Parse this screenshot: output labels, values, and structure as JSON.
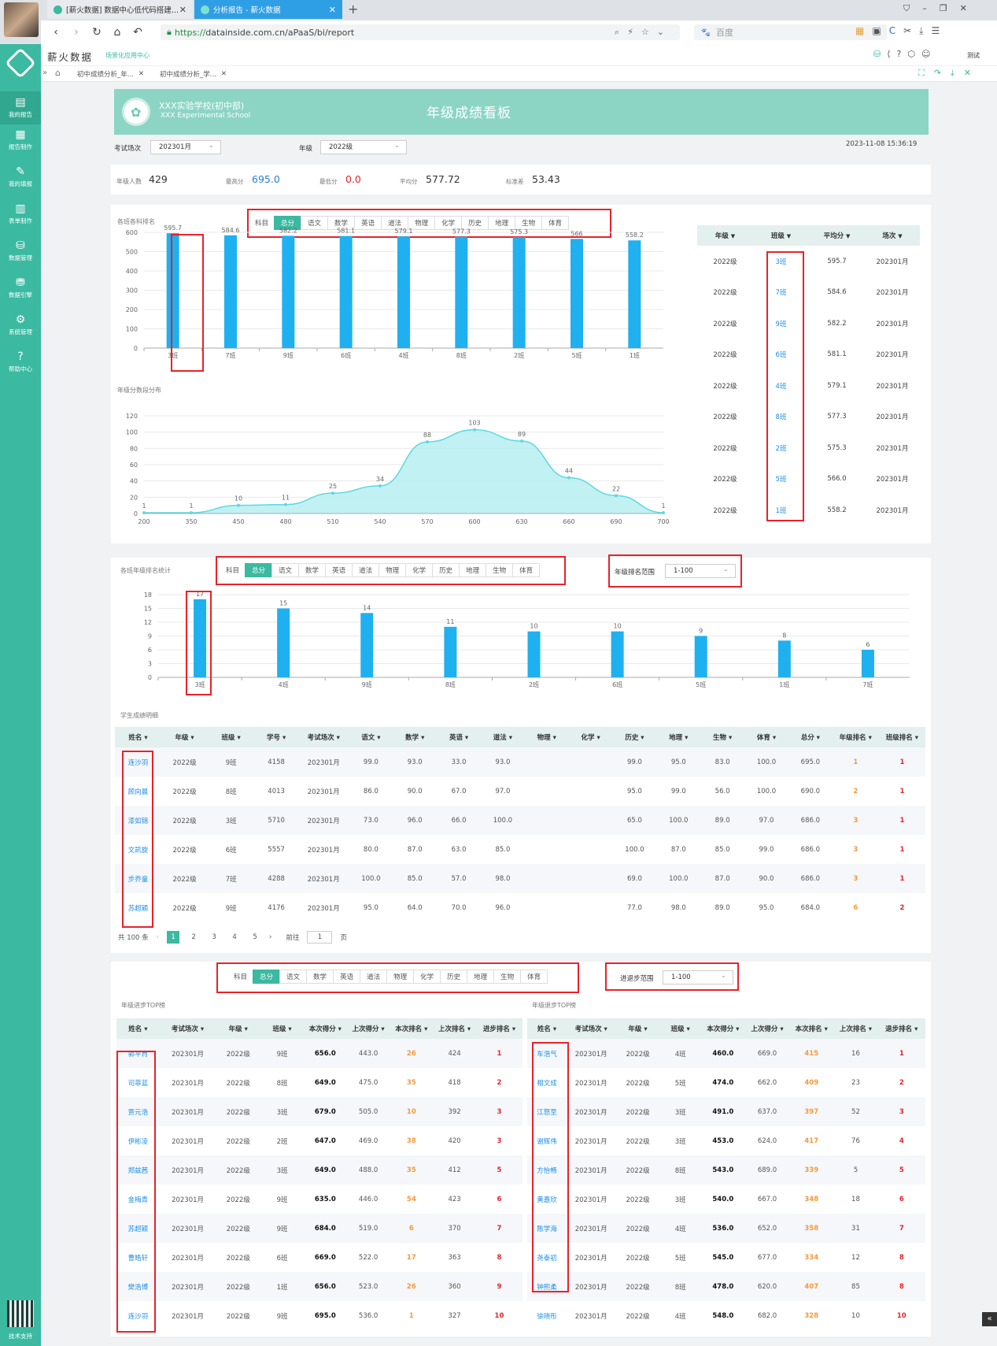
{
  "browser": {
    "tabs": [
      {
        "title": "[薪火数据] 数据中心低代码搭建..."
      },
      {
        "title": "分析报告 - 薪火数据"
      }
    ],
    "url_secure": "https://",
    "url": "datainside.com.cn/aPaaS/bi/report",
    "search_placeholder": "百度",
    "new_tab": "+"
  },
  "app": {
    "brand": "薪火数据",
    "sub_link": "场景化应用中心",
    "user": "测试",
    "tabs": [
      {
        "label": "初中成绩分析_年..."
      },
      {
        "label": "初中成绩分析_学..."
      }
    ]
  },
  "sidebar": {
    "items": [
      {
        "label": "我的报告"
      },
      {
        "label": "报告制作"
      },
      {
        "label": "我的填报"
      },
      {
        "label": "表单制作"
      },
      {
        "label": "数据管理"
      },
      {
        "label": "数据引擎"
      },
      {
        "label": "系统管理"
      },
      {
        "label": "帮助中心"
      }
    ],
    "footer": "技术支持"
  },
  "banner": {
    "school_cn": "XXX实验学校(初中部)",
    "school_en": "XXX Experimental School",
    "title": "年级成绩看板"
  },
  "filters": {
    "exam_label": "考试场次",
    "exam_value": "202301月",
    "grade_label": "年级",
    "grade_value": "2022级",
    "timestamp": "2023-11-08 15:36:19"
  },
  "stats": {
    "count_label": "年级人数",
    "count": "429",
    "max_label": "最高分",
    "max": "695.0",
    "min_label": "最低分",
    "min": "0.0",
    "avg_label": "平均分",
    "avg": "577.72",
    "std_label": "标准差",
    "std": "53.43"
  },
  "subject_filter": {
    "label": "科目",
    "subjects": [
      "总分",
      "语文",
      "数学",
      "英语",
      "道法",
      "物理",
      "化学",
      "历史",
      "地理",
      "生物",
      "体育"
    ]
  },
  "class_rank_chart": {
    "title": "各班各科排名",
    "chart_data": {
      "type": "bar",
      "categories": [
        "3班",
        "7班",
        "9班",
        "6班",
        "4班",
        "8班",
        "2班",
        "5班",
        "1班"
      ],
      "values": [
        595.7,
        584.6,
        582.2,
        581.1,
        579.1,
        577.3,
        575.3,
        566.0,
        558.2
      ],
      "ylim": [
        0,
        600
      ],
      "yticks": [
        "600",
        "500",
        "400",
        "300",
        "200",
        "100",
        "0"
      ],
      "color": "#1fb0f0"
    }
  },
  "class_rank_table": {
    "headers": [
      "年级",
      "班级",
      "平均分",
      "场次"
    ],
    "rows": [
      [
        "2022级",
        "3班",
        "595.7",
        "202301月"
      ],
      [
        "2022级",
        "7班",
        "584.6",
        "202301月"
      ],
      [
        "2022级",
        "9班",
        "582.2",
        "202301月"
      ],
      [
        "2022级",
        "6班",
        "581.1",
        "202301月"
      ],
      [
        "2022级",
        "4班",
        "579.1",
        "202301月"
      ],
      [
        "2022级",
        "8班",
        "577.3",
        "202301月"
      ],
      [
        "2022级",
        "2班",
        "575.3",
        "202301月"
      ],
      [
        "2022级",
        "5班",
        "566.0",
        "202301月"
      ],
      [
        "2022级",
        "1班",
        "558.2",
        "202301月"
      ]
    ]
  },
  "dist_chart": {
    "title": "年级分数段分布",
    "chart_data": {
      "type": "area",
      "x": [
        "200",
        "350",
        "450",
        "480",
        "510",
        "540",
        "570",
        "600",
        "630",
        "660",
        "690",
        "700"
      ],
      "values": [
        1,
        1,
        10,
        11,
        25,
        34,
        88,
        103,
        89,
        44,
        22,
        1
      ],
      "ylim": [
        0,
        120
      ],
      "yticks": [
        "120",
        "100",
        "80",
        "60",
        "40",
        "20",
        "0"
      ],
      "color": "#5dd8e2"
    }
  },
  "grade_rank_chart": {
    "title": "各班年级排名统计",
    "range_label": "年级排名范围",
    "range_value": "1-100",
    "chart_data": {
      "type": "bar",
      "categories": [
        "3班",
        "4班",
        "9班",
        "8班",
        "2班",
        "6班",
        "5班",
        "1班",
        "7班"
      ],
      "values": [
        17,
        15,
        14,
        11,
        10,
        10,
        9,
        8,
        6
      ],
      "ylim": [
        0,
        18
      ],
      "yticks": [
        "18",
        "15",
        "12",
        "9",
        "6",
        "3",
        "0"
      ],
      "color": "#1fb0f0"
    }
  },
  "student_table": {
    "title": "学生成绩明细",
    "headers": [
      "姓名",
      "年级",
      "班级",
      "学号",
      "考试场次",
      "语文",
      "数学",
      "英语",
      "道法",
      "物理",
      "化学",
      "历史",
      "地理",
      "生物",
      "体育",
      "总分",
      "年级排名",
      "班级排名"
    ],
    "rows": [
      [
        "连沙羽",
        "2022级",
        "9班",
        "4158",
        "202301月",
        "99.0",
        "93.0",
        "33.0",
        "93.0",
        "",
        "",
        "99.0",
        "95.0",
        "83.0",
        "100.0",
        "695.0",
        "1",
        "1"
      ],
      [
        "顾向晨",
        "2022级",
        "8班",
        "4013",
        "202301月",
        "86.0",
        "90.0",
        "67.0",
        "97.0",
        "",
        "",
        "95.0",
        "99.0",
        "56.0",
        "100.0",
        "690.0",
        "2",
        "1"
      ],
      [
        "漆如锦",
        "2022级",
        "3班",
        "5710",
        "202301月",
        "73.0",
        "96.0",
        "66.0",
        "100.0",
        "",
        "",
        "65.0",
        "100.0",
        "89.0",
        "97.0",
        "686.0",
        "3",
        "1"
      ],
      [
        "文凯旋",
        "2022级",
        "6班",
        "5557",
        "202301月",
        "80.0",
        "87.0",
        "63.0",
        "85.0",
        "",
        "",
        "100.0",
        "87.0",
        "85.0",
        "99.0",
        "686.0",
        "3",
        "1"
      ],
      [
        "步乔童",
        "2022级",
        "7班",
        "4288",
        "202301月",
        "100.0",
        "85.0",
        "57.0",
        "98.0",
        "",
        "",
        "69.0",
        "100.0",
        "87.0",
        "90.0",
        "686.0",
        "3",
        "1"
      ],
      [
        "苏超颖",
        "2022级",
        "9班",
        "4176",
        "202301月",
        "95.0",
        "64.0",
        "70.0",
        "96.0",
        "",
        "",
        "77.0",
        "98.0",
        "89.0",
        "95.0",
        "684.0",
        "6",
        "2"
      ]
    ],
    "pager": {
      "total": "共 100 条",
      "pages": [
        "1",
        "2",
        "3",
        "4",
        "5"
      ],
      "goto": "前往",
      "goto_value": "1",
      "page_unit": "页"
    }
  },
  "progress": {
    "range_label": "进退步范围",
    "range_value": "1-100",
    "left": {
      "title": "年级进步TOP榜",
      "headers": [
        "姓名",
        "考试场次",
        "年级",
        "班级",
        "本次得分",
        "上次得分",
        "本次排名",
        "上次排名",
        "进步排名"
      ],
      "rows": [
        [
          "郭平肖",
          "202301月",
          "2022级",
          "9班",
          "656.0",
          "443.0",
          "26",
          "424",
          "1"
        ],
        [
          "司菲蓝",
          "202301月",
          "2022级",
          "8班",
          "649.0",
          "475.0",
          "35",
          "418",
          "2"
        ],
        [
          "贾元浩",
          "202301月",
          "2022级",
          "3班",
          "679.0",
          "505.0",
          "10",
          "392",
          "3"
        ],
        [
          "伊彬凌",
          "202301月",
          "2022级",
          "2班",
          "647.0",
          "469.0",
          "38",
          "420",
          "3"
        ],
        [
          "郑兹茜",
          "202301月",
          "2022级",
          "3班",
          "649.0",
          "488.0",
          "35",
          "412",
          "5"
        ],
        [
          "金梅青",
          "202301月",
          "2022级",
          "9班",
          "635.0",
          "446.0",
          "54",
          "423",
          "6"
        ],
        [
          "苏超颖",
          "202301月",
          "2022级",
          "9班",
          "684.0",
          "519.0",
          "6",
          "370",
          "7"
        ],
        [
          "曹皓轩",
          "202301月",
          "2022级",
          "6班",
          "669.0",
          "522.0",
          "17",
          "363",
          "8"
        ],
        [
          "樊浩博",
          "202301月",
          "2022级",
          "1班",
          "656.0",
          "523.0",
          "26",
          "360",
          "9"
        ],
        [
          "连沙羽",
          "202301月",
          "2022级",
          "9班",
          "695.0",
          "536.0",
          "1",
          "327",
          "10"
        ]
      ]
    },
    "right": {
      "title": "年级退步TOP榜",
      "headers": [
        "姓名",
        "考试场次",
        "年级",
        "班级",
        "本次得分",
        "上次得分",
        "本次排名",
        "上次排名",
        "退步排名"
      ],
      "rows": [
        [
          "车浩气",
          "202301月",
          "2022级",
          "4班",
          "460.0",
          "669.0",
          "415",
          "16",
          "1"
        ],
        [
          "相文成",
          "202301月",
          "2022级",
          "5班",
          "474.0",
          "662.0",
          "409",
          "23",
          "2"
        ],
        [
          "江怒至",
          "202301月",
          "2022级",
          "3班",
          "491.0",
          "637.0",
          "397",
          "52",
          "3"
        ],
        [
          "谢辉伟",
          "202301月",
          "2022级",
          "3班",
          "453.0",
          "624.0",
          "417",
          "76",
          "4"
        ],
        [
          "方怡畅",
          "202301月",
          "2022级",
          "8班",
          "543.0",
          "689.0",
          "339",
          "5",
          "5"
        ],
        [
          "黄嘉欣",
          "202301月",
          "2022级",
          "3班",
          "540.0",
          "667.0",
          "348",
          "18",
          "6"
        ],
        [
          "陈学海",
          "202301月",
          "2022级",
          "4班",
          "536.0",
          "652.0",
          "358",
          "31",
          "7"
        ],
        [
          "尧泰初",
          "202301月",
          "2022级",
          "5班",
          "545.0",
          "677.0",
          "334",
          "12",
          "8"
        ],
        [
          "钟熙柔",
          "202301月",
          "2022级",
          "8班",
          "478.0",
          "620.0",
          "407",
          "85",
          "8"
        ],
        [
          "徐晓彤",
          "202301月",
          "2022级",
          "4班",
          "548.0",
          "682.0",
          "328",
          "10",
          "10"
        ]
      ]
    }
  }
}
